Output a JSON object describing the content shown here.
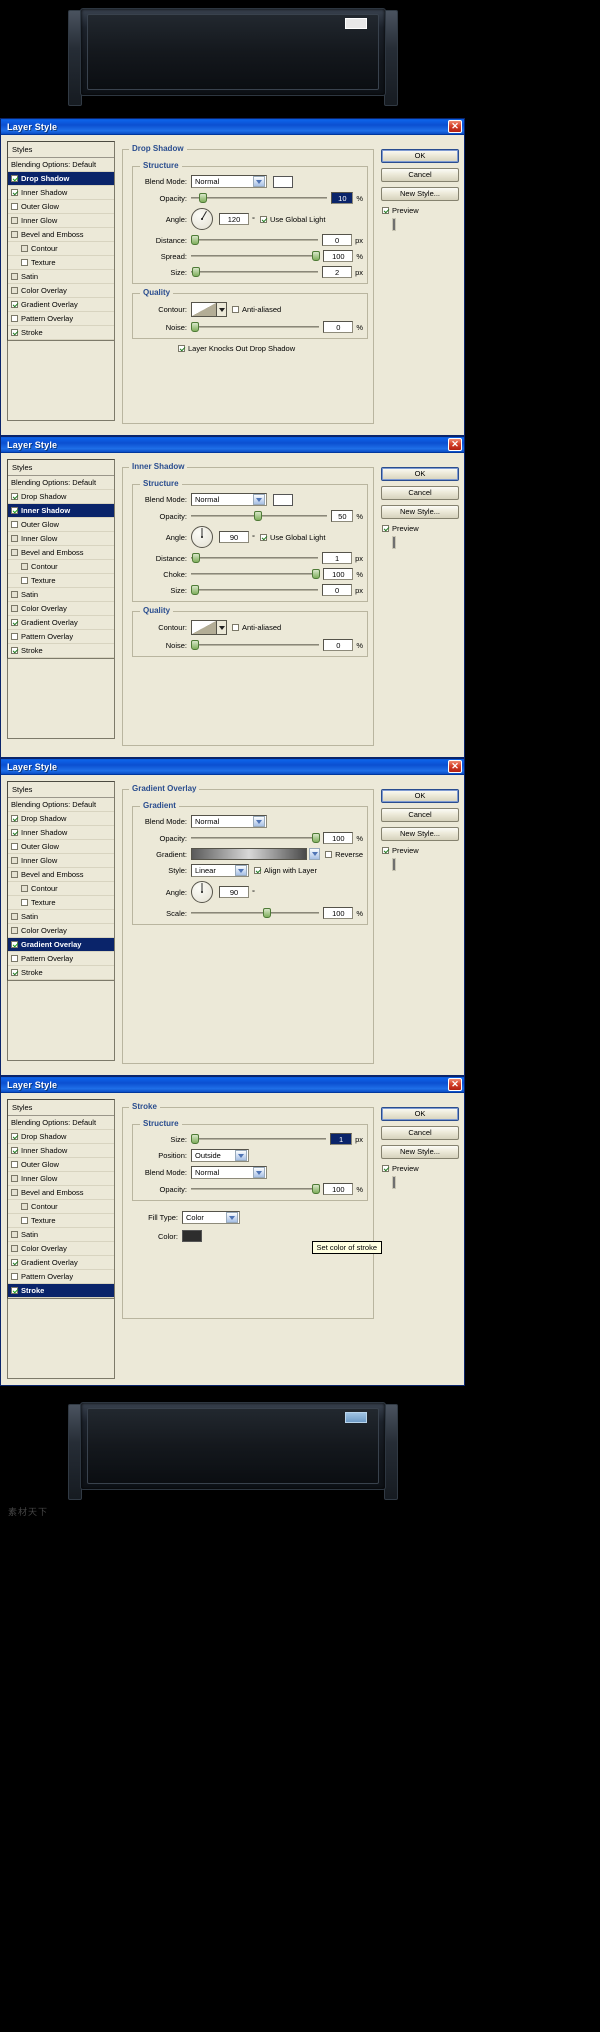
{
  "app": {
    "dialog_title": "Layer Style",
    "close_label": "✕"
  },
  "buttons": {
    "ok": "OK",
    "cancel": "Cancel",
    "new_style": "New Style...",
    "preview": "Preview"
  },
  "styles_list": {
    "header": "Styles",
    "blending": "Blending Options: Default",
    "items": [
      {
        "label": "Drop Shadow",
        "checked": true,
        "sub": false
      },
      {
        "label": "Inner Shadow",
        "checked": true,
        "sub": false
      },
      {
        "label": "Outer Glow",
        "checked": false,
        "sub": false
      },
      {
        "label": "Inner Glow",
        "checked": false,
        "sub": false
      },
      {
        "label": "Bevel and Emboss",
        "checked": false,
        "sub": false
      },
      {
        "label": "Contour",
        "checked": false,
        "sub": true
      },
      {
        "label": "Texture",
        "checked": false,
        "sub": true
      },
      {
        "label": "Satin",
        "checked": false,
        "sub": false
      },
      {
        "label": "Color Overlay",
        "checked": false,
        "sub": false
      },
      {
        "label": "Gradient Overlay",
        "checked": true,
        "sub": false
      },
      {
        "label": "Pattern Overlay",
        "checked": false,
        "sub": false
      },
      {
        "label": "Stroke",
        "checked": true,
        "sub": false
      }
    ]
  },
  "labels": {
    "blend_mode": "Blend Mode:",
    "opacity": "Opacity:",
    "angle": "Angle:",
    "distance": "Distance:",
    "spread": "Spread:",
    "choke": "Choke:",
    "size": "Size:",
    "contour": "Contour:",
    "noise": "Noise:",
    "anti_aliased": "Anti-aliased",
    "use_global_light": "Use Global Light",
    "knocks_out": "Layer Knocks Out Drop Shadow",
    "structure": "Structure",
    "quality": "Quality",
    "gradient_group": "Gradient",
    "gradient": "Gradient:",
    "reverse": "Reverse",
    "style": "Style:",
    "align_with_layer": "Align with Layer",
    "scale": "Scale:",
    "position": "Position:",
    "fill_type": "Fill Type:",
    "color": "Color:",
    "pct": "%",
    "px": "px",
    "deg": "°"
  },
  "panels": {
    "drop_shadow": {
      "title": "Drop Shadow",
      "blend_mode": "Normal",
      "opacity": "10",
      "angle": "120",
      "use_global_light": true,
      "distance": "0",
      "spread": "100",
      "size": "2",
      "anti_aliased": false,
      "noise": "0",
      "layer_knocks_out": true
    },
    "inner_shadow": {
      "title": "Inner Shadow",
      "blend_mode": "Normal",
      "opacity": "50",
      "angle": "90",
      "use_global_light": true,
      "distance": "1",
      "choke": "100",
      "size": "0",
      "anti_aliased": false,
      "noise": "0"
    },
    "gradient_overlay": {
      "title": "Gradient Overlay",
      "blend_mode": "Normal",
      "opacity": "100",
      "reverse": false,
      "style": "Linear",
      "align_with_layer": true,
      "angle": "90",
      "scale": "100"
    },
    "stroke": {
      "title": "Stroke",
      "size": "1",
      "position": "Outside",
      "blend_mode": "Normal",
      "opacity": "100",
      "fill_type": "Color",
      "color_hex": "#2d2d2d",
      "tooltip": "Set color of stroke"
    }
  },
  "artwork": {
    "watermark": "素材天下"
  },
  "colors": {
    "titlebar_blue": "#0b4fd1",
    "dialog_face": "#ece9d8",
    "group_label": "#2a4d8f",
    "selection": "#0a246a",
    "check_green": "#1f7a1f"
  }
}
